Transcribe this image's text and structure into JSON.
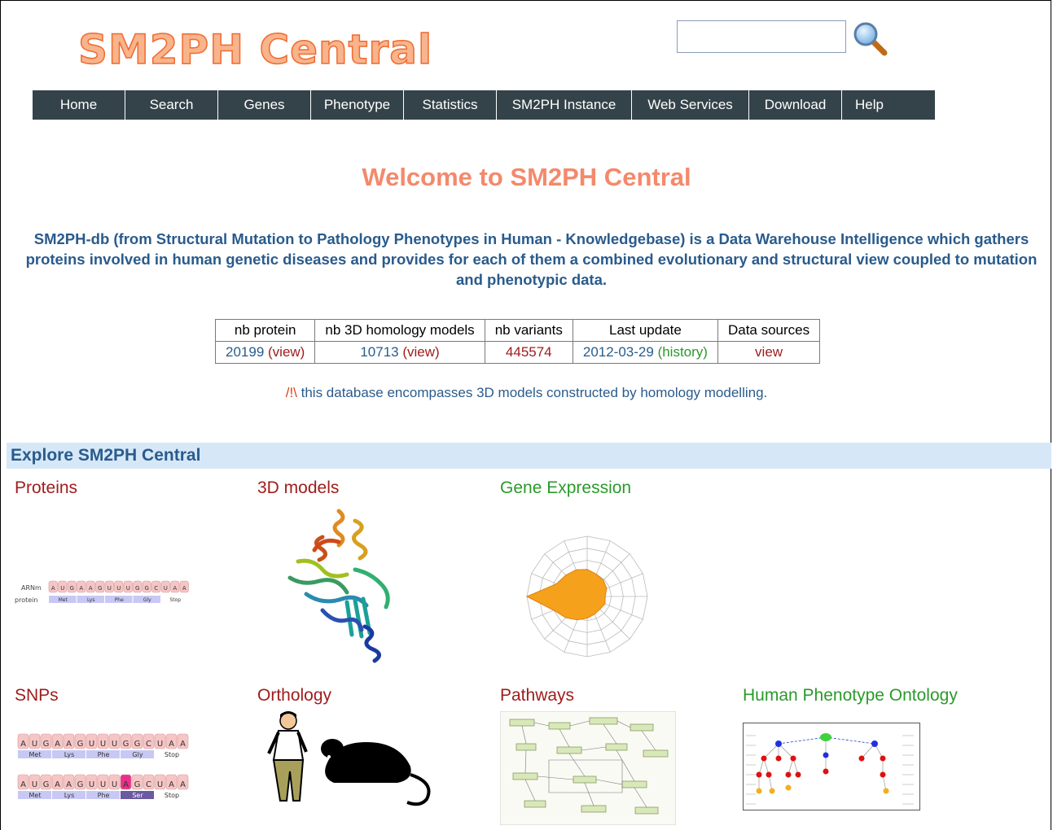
{
  "header": {
    "logo_text": "SM2PH Central",
    "search_placeholder": ""
  },
  "nav": [
    "Home",
    "Search",
    "Genes",
    "Phenotype",
    "Statistics",
    "SM2PH Instance",
    "Web Services",
    "Download",
    "Help"
  ],
  "welcome": "Welcome to SM2PH Central",
  "intro": "SM2PH-db (from Structural Mutation to Pathology Phenotypes in Human - Knowledgebase) is a Data Warehouse Intelligence which gathers proteins involved in human genetic diseases and provides for each of them a combined evolutionary and structural view coupled to mutation and phenotypic data.",
  "stats": {
    "headers": [
      "nb protein",
      "nb 3D homology models",
      "nb variants",
      "Last update",
      "Data sources"
    ],
    "protein_count": "20199",
    "protein_link": "(view)",
    "models_count": "10713",
    "models_link": "(view)",
    "variants": "445574",
    "last_update": "2012-03-29",
    "history_link": "(history)",
    "sources_link": "view"
  },
  "warning": {
    "mark": "/!\\",
    "text": " this database encompasses 3D models constructed by homology modelling."
  },
  "explore": {
    "title": "Explore SM2PH Central",
    "tiles": {
      "proteins": "Proteins",
      "models": "3D models",
      "expression": "Gene Expression",
      "snps": "SNPs",
      "orthology": "Orthology",
      "pathways": "Pathways",
      "hpo": "Human Phenotype Ontology"
    },
    "protein_fig": {
      "row1_label": "ARNm",
      "row2_label": "protein",
      "bases": [
        "A",
        "U",
        "G",
        "A",
        "A",
        "G",
        "U",
        "U",
        "U",
        "G",
        "G",
        "C",
        "U",
        "A",
        "A"
      ],
      "aa": [
        "Met",
        "Lys",
        "Phe",
        "Gly",
        "Stop"
      ]
    },
    "snp_fig": {
      "seq1": [
        "A",
        "U",
        "G",
        "A",
        "A",
        "G",
        "U",
        "U",
        "U",
        "G",
        "G",
        "C",
        "U",
        "A",
        "A"
      ],
      "aa1": [
        "Met",
        "Lys",
        "Phe",
        "Gly",
        "Stop"
      ],
      "seq2": [
        "A",
        "U",
        "G",
        "A",
        "A",
        "G",
        "U",
        "U",
        "U",
        "A",
        "G",
        "C",
        "U",
        "A",
        "A"
      ],
      "aa2": [
        "Met",
        "Lys",
        "Phe",
        "Ser",
        "Stop"
      ]
    }
  },
  "colors": {
    "nav_bg": "#34434a",
    "accent": "#f4896b",
    "link_blue": "#2a5b8c",
    "link_red": "#a01c1c",
    "link_green": "#2a9a2a"
  }
}
